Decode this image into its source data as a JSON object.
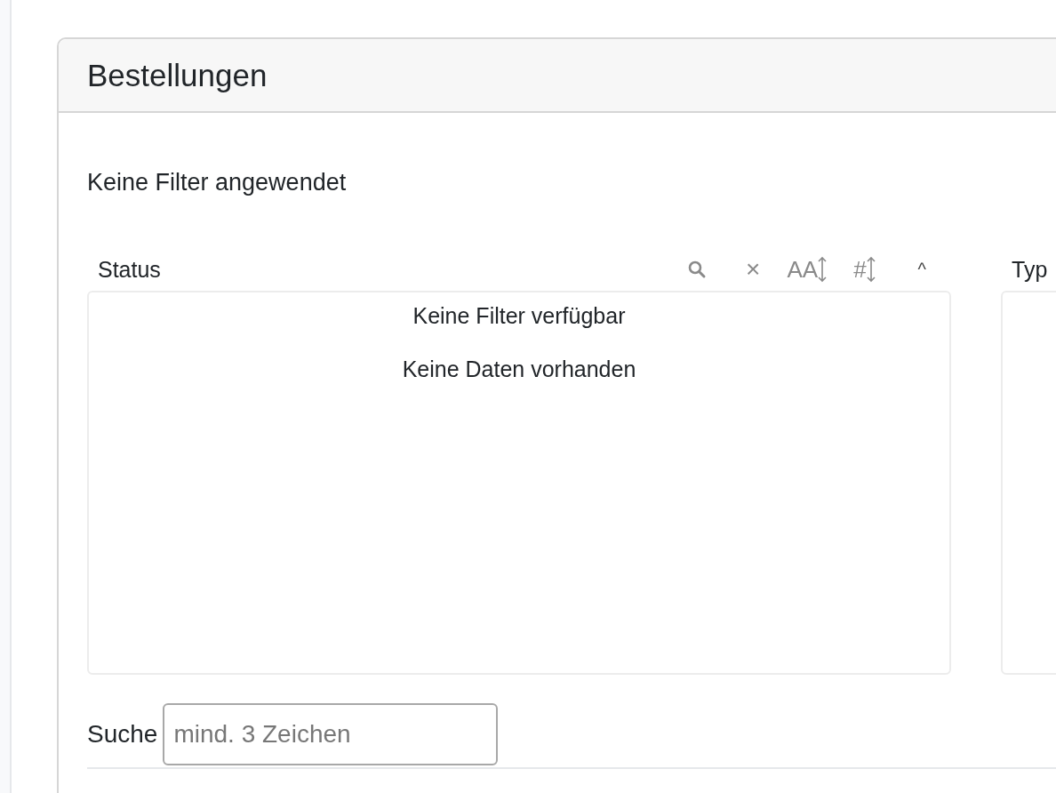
{
  "card": {
    "title": "Bestellungen"
  },
  "filter_summary": "Keine Filter angewendet",
  "filters": [
    {
      "label": "Status",
      "toolbar": {
        "clear": "×",
        "sort_alpha": "AA",
        "sort_numeric": "#",
        "collapse": "^"
      },
      "messages": [
        "Keine Filter verfügbar",
        "Keine Daten vorhanden"
      ]
    },
    {
      "label": "Typ"
    }
  ],
  "search": {
    "label": "Suche",
    "placeholder": "mind. 3 Zeichen"
  }
}
